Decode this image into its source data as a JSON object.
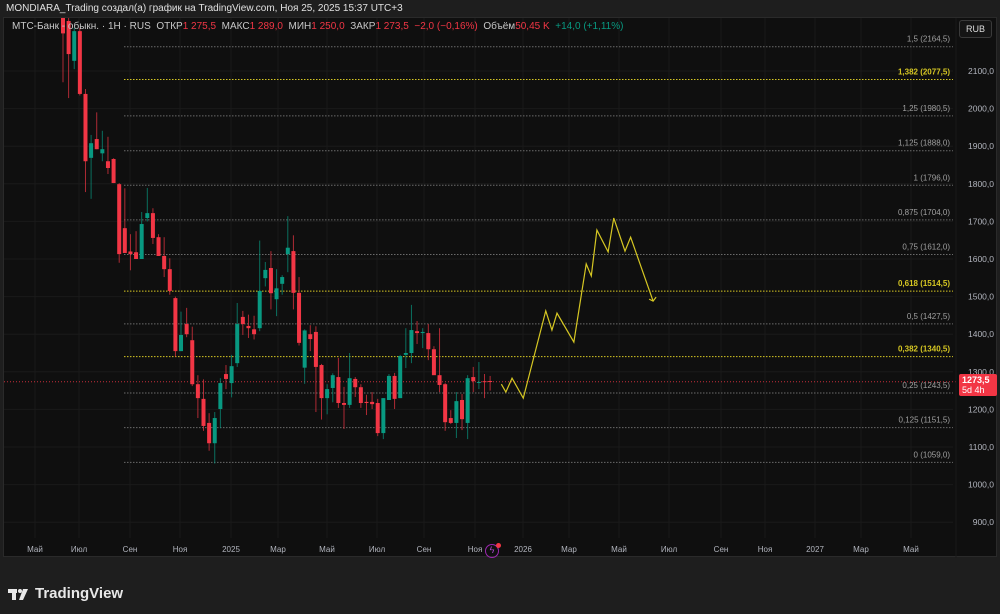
{
  "topbar": {
    "text": "MONDIARA_Trading создал(а) график на TradingView.com, Ноя 25, 2025 15:37 UTC+3"
  },
  "legend": {
    "symbol": "МТС-Банк - обыкн.",
    "interval": "1H",
    "exchange": "RUS",
    "open_label": "ОТКР",
    "open": "1 275,5",
    "high_label": "МАКС",
    "high": "1 289,0",
    "low_label": "МИН",
    "low": "1 250,0",
    "close_label": "ЗАКР",
    "close": "1 273,5",
    "change": "−2,0 (−0,16%)",
    "volume_label": "Объём",
    "volume": "50,45 K",
    "volume_change": "+14,0 (+1,11%)"
  },
  "currency": "RUB",
  "price_tag": {
    "price": "1273,5",
    "countdown": "5d 4h"
  },
  "footer": {
    "brand": "TradingView"
  },
  "colors": {
    "up": "#089981",
    "down": "#f23645",
    "fib_key": "#d6c723",
    "fib": "#6b6b6b",
    "projection": "#d6c723"
  },
  "chart_data": {
    "type": "candlestick",
    "ylim": [
      850,
      2230
    ],
    "price_ticks": [
      "2100,0",
      "2000,0",
      "1900,0",
      "1800,0",
      "1700,0",
      "1600,0",
      "1500,0",
      "1400,0",
      "1300,0",
      "1200,0",
      "1100,0",
      "1000,0",
      "900,0"
    ],
    "price_tick_values": [
      2100,
      2000,
      1900,
      1800,
      1700,
      1600,
      1500,
      1400,
      1300,
      1200,
      1100,
      1000,
      900
    ],
    "time_labels": [
      "Май",
      "Июл",
      "Сен",
      "Ноя",
      "2025",
      "Мар",
      "Май",
      "Июл",
      "Сен",
      "Ноя",
      "2026",
      "Мар",
      "Май",
      "Июл",
      "Сен",
      "Ноя",
      "2027",
      "Мар",
      "Май"
    ],
    "current_price": 1273.5,
    "fib_levels": [
      {
        "label": "1,5 (2164,5)",
        "price": 2164.5,
        "key": false
      },
      {
        "label": "1,382 (2077,5)",
        "price": 2077.5,
        "key": true
      },
      {
        "label": "1,25 (1980,5)",
        "price": 1980.5,
        "key": false
      },
      {
        "label": "1,125 (1888,0)",
        "price": 1888.0,
        "key": false
      },
      {
        "label": "1 (1796,0)",
        "price": 1796.0,
        "key": false
      },
      {
        "label": "0,875 (1704,0)",
        "price": 1704.0,
        "key": false
      },
      {
        "label": "0,75 (1612,0)",
        "price": 1612.0,
        "key": false
      },
      {
        "label": "0,618 (1514,5)",
        "price": 1514.5,
        "key": true
      },
      {
        "label": "0,5 (1427,5)",
        "price": 1427.5,
        "key": false
      },
      {
        "label": "0,382 (1340,5)",
        "price": 1340.5,
        "key": true
      },
      {
        "label": "0,25 (1243,5)",
        "price": 1243.5,
        "key": false
      },
      {
        "label": "0,125 (1151,5)",
        "price": 1151.5,
        "key": false
      },
      {
        "label": "0 (1059,0)",
        "price": 1059.0,
        "key": false
      }
    ],
    "candles_ohlc": [
      [
        2290,
        2300,
        2070,
        2200
      ],
      [
        2233,
        2260,
        2028,
        2145
      ],
      [
        2127,
        2215,
        2105,
        2206
      ],
      [
        2206,
        2215,
        2035,
        2039
      ],
      [
        2039,
        2052,
        1778,
        1860
      ],
      [
        1869,
        1930,
        1760,
        1908
      ],
      [
        1919,
        1990,
        1892,
        1892
      ],
      [
        1881,
        1941,
        1860,
        1892
      ],
      [
        1860,
        1925,
        1826,
        1842
      ],
      [
        1866,
        1868,
        1802,
        1802
      ],
      [
        1799,
        1802,
        1590,
        1613
      ],
      [
        1682,
        1788,
        1616,
        1616
      ],
      [
        1620,
        1666,
        1570,
        1613
      ],
      [
        1618,
        1674,
        1600,
        1600
      ],
      [
        1600,
        1725,
        1600,
        1693
      ],
      [
        1709,
        1789,
        1700,
        1722
      ],
      [
        1722,
        1735,
        1640,
        1656
      ],
      [
        1658,
        1666,
        1608,
        1608
      ],
      [
        1608,
        1658,
        1552,
        1573
      ],
      [
        1573,
        1602,
        1505,
        1515
      ],
      [
        1496,
        1500,
        1340,
        1355
      ],
      [
        1355,
        1460,
        1355,
        1398
      ],
      [
        1427,
        1470,
        1392,
        1400
      ],
      [
        1384,
        1420,
        1262,
        1267
      ],
      [
        1267,
        1291,
        1177,
        1230
      ],
      [
        1228,
        1280,
        1143,
        1156
      ],
      [
        1164,
        1190,
        1090,
        1110
      ],
      [
        1110,
        1193,
        1056,
        1177
      ],
      [
        1201,
        1283,
        1150,
        1270
      ],
      [
        1294,
        1318,
        1254,
        1281
      ],
      [
        1270,
        1345,
        1232,
        1315
      ],
      [
        1323,
        1483,
        1313,
        1427
      ],
      [
        1446,
        1462,
        1398,
        1427
      ],
      [
        1422,
        1452,
        1390,
        1416
      ],
      [
        1413,
        1449,
        1386,
        1400
      ],
      [
        1416,
        1649,
        1408,
        1515
      ],
      [
        1549,
        1592,
        1527,
        1571
      ],
      [
        1576,
        1621,
        1466,
        1509
      ],
      [
        1493,
        1573,
        1448,
        1522
      ],
      [
        1534,
        1557,
        1505,
        1552
      ],
      [
        1613,
        1714,
        1565,
        1630
      ],
      [
        1621,
        1663,
        1466,
        1510
      ],
      [
        1510,
        1552,
        1370,
        1377
      ],
      [
        1311,
        1413,
        1268,
        1410
      ],
      [
        1400,
        1424,
        1355,
        1387
      ],
      [
        1406,
        1421,
        1193,
        1313
      ],
      [
        1318,
        1321,
        1173,
        1230
      ],
      [
        1230,
        1267,
        1187,
        1254
      ],
      [
        1257,
        1296,
        1219,
        1291
      ],
      [
        1286,
        1337,
        1204,
        1217
      ],
      [
        1217,
        1260,
        1148,
        1212
      ],
      [
        1212,
        1350,
        1204,
        1283
      ],
      [
        1281,
        1286,
        1233,
        1259
      ],
      [
        1259,
        1267,
        1204,
        1217
      ],
      [
        1220,
        1239,
        1185,
        1217
      ],
      [
        1220,
        1246,
        1201,
        1214
      ],
      [
        1217,
        1228,
        1129,
        1137
      ],
      [
        1137,
        1230,
        1121,
        1230
      ],
      [
        1225,
        1294,
        1225,
        1289
      ],
      [
        1289,
        1297,
        1201,
        1228
      ],
      [
        1230,
        1345,
        1230,
        1342
      ],
      [
        1345,
        1416,
        1310,
        1350
      ],
      [
        1350,
        1478,
        1323,
        1411
      ],
      [
        1408,
        1435,
        1374,
        1403
      ],
      [
        1403,
        1416,
        1363,
        1406
      ],
      [
        1403,
        1427,
        1331,
        1360
      ],
      [
        1360,
        1368,
        1299,
        1291
      ],
      [
        1291,
        1416,
        1246,
        1265
      ],
      [
        1267,
        1270,
        1143,
        1166
      ],
      [
        1177,
        1198,
        1161,
        1164
      ],
      [
        1164,
        1246,
        1124,
        1222
      ],
      [
        1225,
        1241,
        1145,
        1174
      ],
      [
        1164,
        1291,
        1121,
        1283
      ],
      [
        1286,
        1313,
        1246,
        1275
      ],
      [
        1271,
        1326,
        1254,
        1273
      ],
      [
        1275,
        1294,
        1230,
        1273
      ],
      [
        1275.5,
        1289,
        1250,
        1273.5
      ]
    ],
    "projection_path": [
      [
        78,
        1267
      ],
      [
        78.8,
        1246
      ],
      [
        79.9,
        1283
      ],
      [
        81.9,
        1230
      ],
      [
        85.9,
        1462
      ],
      [
        87,
        1411
      ],
      [
        87.9,
        1456
      ],
      [
        90.9,
        1379
      ],
      [
        93.1,
        1587
      ],
      [
        94,
        1555
      ],
      [
        95,
        1677
      ],
      [
        97,
        1619
      ],
      [
        98,
        1709
      ],
      [
        100,
        1621
      ],
      [
        101,
        1658
      ],
      [
        105,
        1488
      ]
    ]
  }
}
